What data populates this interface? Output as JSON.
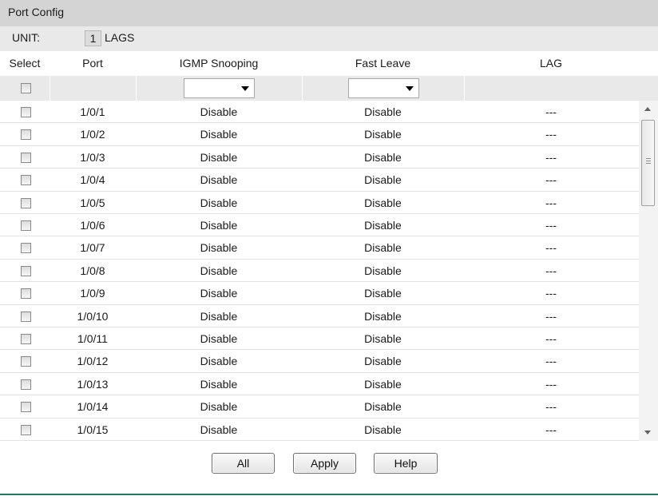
{
  "panel": {
    "title": "Port Config"
  },
  "unit": {
    "label": "UNIT:",
    "selected": "1",
    "lags_label": "LAGS"
  },
  "table": {
    "headers": {
      "select": "Select",
      "port": "Port",
      "igmp": "IGMP Snooping",
      "fast_leave": "Fast Leave",
      "lag": "LAG"
    },
    "filter": {
      "igmp_value": "",
      "fast_leave_value": ""
    },
    "rows": [
      {
        "port": "1/0/1",
        "igmp": "Disable",
        "fast_leave": "Disable",
        "lag": "---"
      },
      {
        "port": "1/0/2",
        "igmp": "Disable",
        "fast_leave": "Disable",
        "lag": "---"
      },
      {
        "port": "1/0/3",
        "igmp": "Disable",
        "fast_leave": "Disable",
        "lag": "---"
      },
      {
        "port": "1/0/4",
        "igmp": "Disable",
        "fast_leave": "Disable",
        "lag": "---"
      },
      {
        "port": "1/0/5",
        "igmp": "Disable",
        "fast_leave": "Disable",
        "lag": "---"
      },
      {
        "port": "1/0/6",
        "igmp": "Disable",
        "fast_leave": "Disable",
        "lag": "---"
      },
      {
        "port": "1/0/7",
        "igmp": "Disable",
        "fast_leave": "Disable",
        "lag": "---"
      },
      {
        "port": "1/0/8",
        "igmp": "Disable",
        "fast_leave": "Disable",
        "lag": "---"
      },
      {
        "port": "1/0/9",
        "igmp": "Disable",
        "fast_leave": "Disable",
        "lag": "---"
      },
      {
        "port": "1/0/10",
        "igmp": "Disable",
        "fast_leave": "Disable",
        "lag": "---"
      },
      {
        "port": "1/0/11",
        "igmp": "Disable",
        "fast_leave": "Disable",
        "lag": "---"
      },
      {
        "port": "1/0/12",
        "igmp": "Disable",
        "fast_leave": "Disable",
        "lag": "---"
      },
      {
        "port": "1/0/13",
        "igmp": "Disable",
        "fast_leave": "Disable",
        "lag": "---"
      },
      {
        "port": "1/0/14",
        "igmp": "Disable",
        "fast_leave": "Disable",
        "lag": "---"
      },
      {
        "port": "1/0/15",
        "igmp": "Disable",
        "fast_leave": "Disable",
        "lag": "---"
      }
    ]
  },
  "buttons": {
    "all": "All",
    "apply": "Apply",
    "help": "Help"
  },
  "colors": {
    "title_bar": "#d4d4d4",
    "unit_bar": "#e9e9e9",
    "footer_line": "#1f7a6a"
  }
}
